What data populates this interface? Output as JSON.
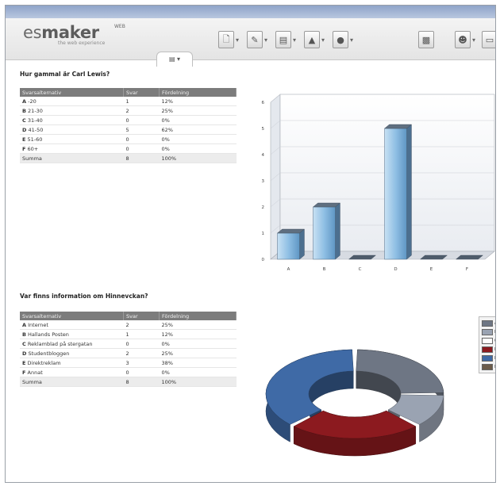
{
  "app": {
    "logo": "maker",
    "logo_prefix": "es",
    "logo_sup": "WEB",
    "tagline": "the web experience",
    "view_tab": "▤ ▾"
  },
  "toolbar": {
    "icons": [
      "page-icon",
      "pen-icon",
      "chart-icon",
      "export-icon",
      "image-icon",
      "print-icon",
      "user-icon",
      "book-icon"
    ]
  },
  "questions": [
    {
      "title": "Hur gammal är Carl Lewis?",
      "headers": [
        "Svarsalternativ",
        "Svar",
        "Fördelning"
      ],
      "rows": [
        {
          "letter": "A",
          "label": "-20",
          "count": "1",
          "pct": "12%"
        },
        {
          "letter": "B",
          "label": "21-30",
          "count": "2",
          "pct": "25%"
        },
        {
          "letter": "C",
          "label": "31-40",
          "count": "0",
          "pct": "0%"
        },
        {
          "letter": "D",
          "label": "41-50",
          "count": "5",
          "pct": "62%"
        },
        {
          "letter": "E",
          "label": "51-60",
          "count": "0",
          "pct": "0%"
        },
        {
          "letter": "F",
          "label": "60+",
          "count": "0",
          "pct": "0%"
        }
      ],
      "total": {
        "label": "Summa",
        "count": "8",
        "pct": "100%"
      }
    },
    {
      "title": "Var finns information om Hinnevckan?",
      "headers": [
        "Svarsalternativ",
        "Svar",
        "Fördelning"
      ],
      "rows": [
        {
          "letter": "A",
          "label": "Internet",
          "count": "2",
          "pct": "25%"
        },
        {
          "letter": "B",
          "label": "Hallands Posten",
          "count": "1",
          "pct": "12%"
        },
        {
          "letter": "C",
          "label": "Reklamblad på stergatan",
          "count": "0",
          "pct": "0%"
        },
        {
          "letter": "D",
          "label": "Studentbloggen",
          "count": "2",
          "pct": "25%"
        },
        {
          "letter": "E",
          "label": "Direktreklam",
          "count": "3",
          "pct": "38%"
        },
        {
          "letter": "F",
          "label": "Annat",
          "count": "0",
          "pct": "0%"
        }
      ],
      "total": {
        "label": "Summa",
        "count": "8",
        "pct": "100%"
      }
    }
  ],
  "chart_data": [
    {
      "type": "bar",
      "categories": [
        "A",
        "B",
        "C",
        "D",
        "E",
        "F"
      ],
      "values": [
        1,
        2,
        0,
        5,
        0,
        0
      ],
      "ylim": [
        0,
        6
      ],
      "yticks": [
        "0",
        "1",
        "2",
        "3",
        "4",
        "5",
        "6"
      ],
      "grid": true,
      "color": "#8fbfe4"
    },
    {
      "type": "pie",
      "style": "donut-3d",
      "categories": [
        "A",
        "B",
        "C",
        "D",
        "E",
        "F"
      ],
      "values": [
        2,
        1,
        0,
        2,
        3,
        0
      ],
      "colors": [
        "#6e7684",
        "#9aa3b2",
        "#ffffff",
        "#8c1a1f",
        "#3f6aa6",
        "#6b5b4a"
      ],
      "legend": "right"
    }
  ]
}
